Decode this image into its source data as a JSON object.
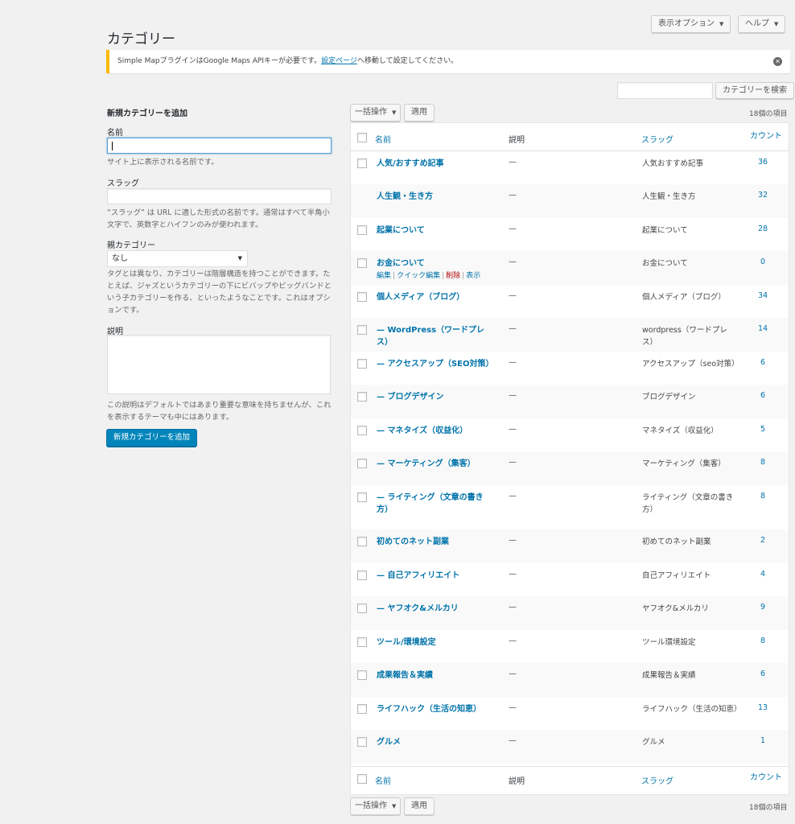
{
  "header": {
    "screen_options": "表示オプション",
    "help": "ヘルプ",
    "page_title": "カテゴリー"
  },
  "notice": {
    "text_before": "Simple Mapプラグインは",
    "text_mid": "Google Maps APIキーが必要です。",
    "link": "設定ページ",
    "text_after": "へ移動して設定してください。"
  },
  "search": {
    "button": "カテゴリーを検索",
    "value": ""
  },
  "form": {
    "heading": "新規カテゴリーを追加",
    "name_label": "名前",
    "name_help": "サイト上に表示される名前です。",
    "slug_label": "スラッグ",
    "slug_help": "“スラッグ” は URL に適した形式の名前です。通常はすべて半角小文字で、英数字とハイフンのみが使われます。",
    "parent_label": "親カテゴリー",
    "parent_selected": "なし",
    "parent_help": "タグとは異なり、カテゴリーは階層構造を持つことができます。たとえば、ジャズというカテゴリーの下にビバップやビッグバンドという子カテゴリーを作る、といったようなことです。これはオプションです。",
    "desc_label": "説明",
    "desc_help": "この説明はデフォルトではあまり重要な意味を持ちませんが、これを表示するテーマも中にはあります。",
    "submit": "新規カテゴリーを追加"
  },
  "bulk": {
    "label": "一括操作",
    "apply": "適用",
    "count_text": "18個の項目"
  },
  "table": {
    "columns": {
      "name": "名前",
      "desc": "説明",
      "slug": "スラッグ",
      "count": "カウント"
    },
    "row_actions": {
      "edit": "編集",
      "quick_edit": "クイック編集",
      "delete": "削除",
      "view": "表示"
    },
    "rows": [
      {
        "name": "人気/おすすめ記事",
        "desc": "—",
        "slug": "人気おすすめ記事",
        "count": "36"
      },
      {
        "name": "人生観・生き方",
        "desc": "—",
        "slug": "人生観・生き方",
        "count": "32"
      },
      {
        "name": "起業について",
        "desc": "—",
        "slug": "起業について",
        "count": "28"
      },
      {
        "name": "お金について",
        "desc": "—",
        "slug": "お金について",
        "count": "0"
      },
      {
        "name": "個人メディア（ブログ）",
        "desc": "—",
        "slug": "個人メディア（ブログ）",
        "count": "34"
      },
      {
        "name": "— WordPress（ワードプレス）",
        "desc": "—",
        "slug": "wordpress（ワードプレス）",
        "count": "14"
      },
      {
        "name": "— アクセスアップ（SEO対策）",
        "desc": "—",
        "slug": "アクセスアップ（seo対策）",
        "count": "6"
      },
      {
        "name": "— ブログデザイン",
        "desc": "—",
        "slug": "ブログデザイン",
        "count": "6"
      },
      {
        "name": "— マネタイズ（収益化）",
        "desc": "—",
        "slug": "マネタイズ（収益化）",
        "count": "5"
      },
      {
        "name": "— マーケティング（集客）",
        "desc": "—",
        "slug": "マーケティング（集客）",
        "count": "8"
      },
      {
        "name": "— ライティング（文章の書き方）",
        "desc": "—",
        "slug": "ライティング（文章の書き方）",
        "count": "8"
      },
      {
        "name": "初めてのネット副業",
        "desc": "—",
        "slug": "初めてのネット副業",
        "count": "2"
      },
      {
        "name": "— 自己アフィリエイト",
        "desc": "—",
        "slug": "自己アフィリエイト",
        "count": "4"
      },
      {
        "name": "— ヤフオク&メルカリ",
        "desc": "—",
        "slug": "ヤフオク&メルカリ",
        "count": "9"
      },
      {
        "name": "ツール/環境設定",
        "desc": "—",
        "slug": "ツール環境設定",
        "count": "8"
      },
      {
        "name": "成果報告＆実績",
        "desc": "—",
        "slug": "成果報告＆実績",
        "count": "6"
      },
      {
        "name": "ライフハック（生活の知恵）",
        "desc": "—",
        "slug": "ライフハック（生活の知恵）",
        "count": "13"
      },
      {
        "name": "グルメ",
        "desc": "—",
        "slug": "グルメ",
        "count": "1"
      }
    ]
  },
  "colors": {
    "link": "#0073aa",
    "primary": "#0085ba",
    "notice_border": "#ffb900",
    "delete": "#a00000"
  }
}
